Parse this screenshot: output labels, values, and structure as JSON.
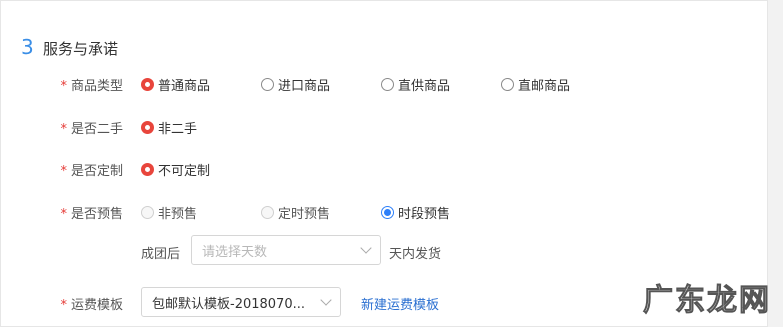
{
  "section": {
    "number": "3",
    "title": "服务与承诺"
  },
  "required_mark": "*",
  "product_type": {
    "label": "商品类型",
    "options": [
      "普通商品",
      "进口商品",
      "直供商品",
      "直邮商品"
    ],
    "selected": "普通商品"
  },
  "second_hand": {
    "label": "是否二手",
    "option": "非二手"
  },
  "customized": {
    "label": "是否定制",
    "option": "不可定制"
  },
  "presale": {
    "label": "是否预售",
    "options": [
      "非预售",
      "定时预售",
      "时段预售"
    ],
    "selected": "时段预售",
    "after_group_label": "成团后",
    "days_placeholder": "请选择天数",
    "ship_suffix": "天内发货"
  },
  "shipping": {
    "label": "运费模板",
    "selected_template": "包邮默认模板-2018070...",
    "new_template_link": "新建运费模板"
  },
  "watermark": "广东龙网",
  "colors": {
    "accent_blue": "#2d7ff9",
    "radio_red": "#e8453c",
    "required_red": "#e53935",
    "link_blue": "#2a6fd1"
  }
}
